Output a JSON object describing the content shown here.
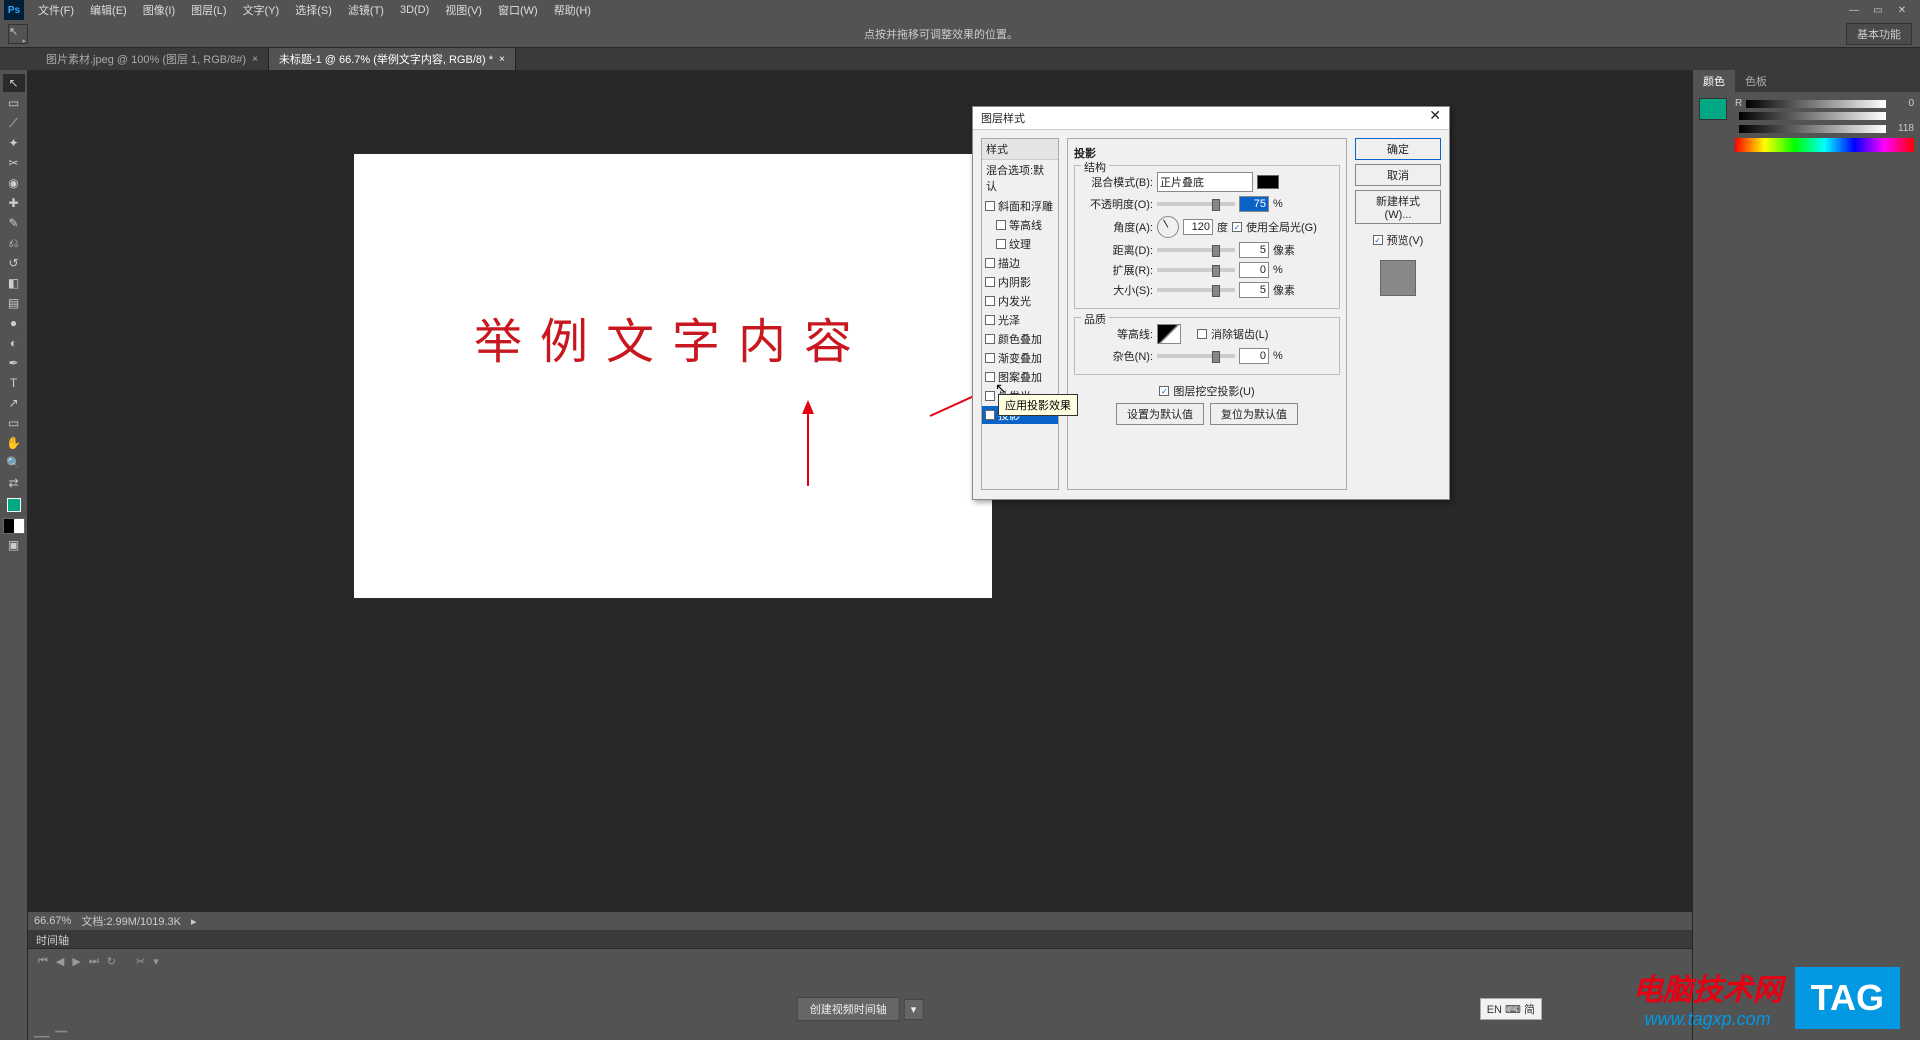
{
  "app": {
    "name": "Ps"
  },
  "menu": [
    "文件(F)",
    "编辑(E)",
    "图像(I)",
    "图层(L)",
    "文字(Y)",
    "选择(S)",
    "滤镜(T)",
    "3D(D)",
    "视图(V)",
    "窗口(W)",
    "帮助(H)"
  ],
  "options_bar": {
    "message": "点按并拖移可调整效果的位置。",
    "basic": "基本功能"
  },
  "tabs": [
    {
      "label": "图片素材.jpeg @ 100% (图层 1, RGB/8#)",
      "close": "×"
    },
    {
      "label": "未标题-1 @ 66.7% (举例文字内容, RGB/8) *",
      "close": "×"
    }
  ],
  "canvas_text": "举例文字内容",
  "status": {
    "zoom": "66.67%",
    "doc": "文档:2.99M/1019.3K"
  },
  "timeline": {
    "title": "时间轴",
    "create_btn": "创建视频时间轴",
    "controls": [
      "⏮",
      "◀",
      "▶",
      "⏭",
      "↻",
      "✂",
      "▾"
    ]
  },
  "panels": {
    "color": {
      "tabs": [
        "颜色",
        "色板"
      ],
      "r_label": "R",
      "g_label": "",
      "b_label": "",
      "r": "0",
      "g": "",
      "b": "118"
    }
  },
  "dialog": {
    "title": "图层样式",
    "close": "✕",
    "list_header": "样式",
    "blend_default": "混合选项:默认",
    "items": [
      {
        "label": "斜面和浮雕",
        "checked": false,
        "indent": false
      },
      {
        "label": "等高线",
        "checked": false,
        "indent": true
      },
      {
        "label": "纹理",
        "checked": false,
        "indent": true
      },
      {
        "label": "描边",
        "checked": false,
        "indent": false
      },
      {
        "label": "内阴影",
        "checked": false,
        "indent": false
      },
      {
        "label": "内发光",
        "checked": false,
        "indent": false
      },
      {
        "label": "光泽",
        "checked": false,
        "indent": false
      },
      {
        "label": "颜色叠加",
        "checked": false,
        "indent": false
      },
      {
        "label": "渐变叠加",
        "checked": false,
        "indent": false
      },
      {
        "label": "图案叠加",
        "checked": false,
        "indent": false
      },
      {
        "label": "外发光",
        "checked": false,
        "indent": false
      },
      {
        "label": "投影",
        "checked": true,
        "indent": false,
        "selected": true
      }
    ],
    "panel_title": "投影",
    "sections": {
      "structure": "结构",
      "quality": "品质"
    },
    "labels": {
      "blend_mode": "混合模式(B):",
      "opacity": "不透明度(O):",
      "angle": "角度(A):",
      "degree": "度",
      "global": "使用全局光(G)",
      "distance": "距离(D):",
      "spread": "扩展(R):",
      "size": "大小(S):",
      "px": "像素",
      "pct": "%",
      "contour": "等高线:",
      "anti": "消除锯齿(L)",
      "noise": "杂色(N):",
      "knockout": "图层挖空投影(U)",
      "set_default": "设置为默认值",
      "reset_default": "复位为默认值"
    },
    "values": {
      "blend_mode": "正片叠底",
      "opacity": "75",
      "angle": "120",
      "distance": "5",
      "spread": "0",
      "size": "5",
      "noise": "0",
      "global": true,
      "anti": false,
      "knockout": true
    },
    "buttons": {
      "ok": "确定",
      "cancel": "取消",
      "new_style": "新建样式(W)...",
      "preview": "预览(V)"
    },
    "preview_checked": true
  },
  "tooltip": "应用投影效果",
  "ime": "EN ⌨ 简",
  "watermark": {
    "line1": "电脑技术网",
    "line2": "www.tagxp.com",
    "tag": "TAG"
  }
}
